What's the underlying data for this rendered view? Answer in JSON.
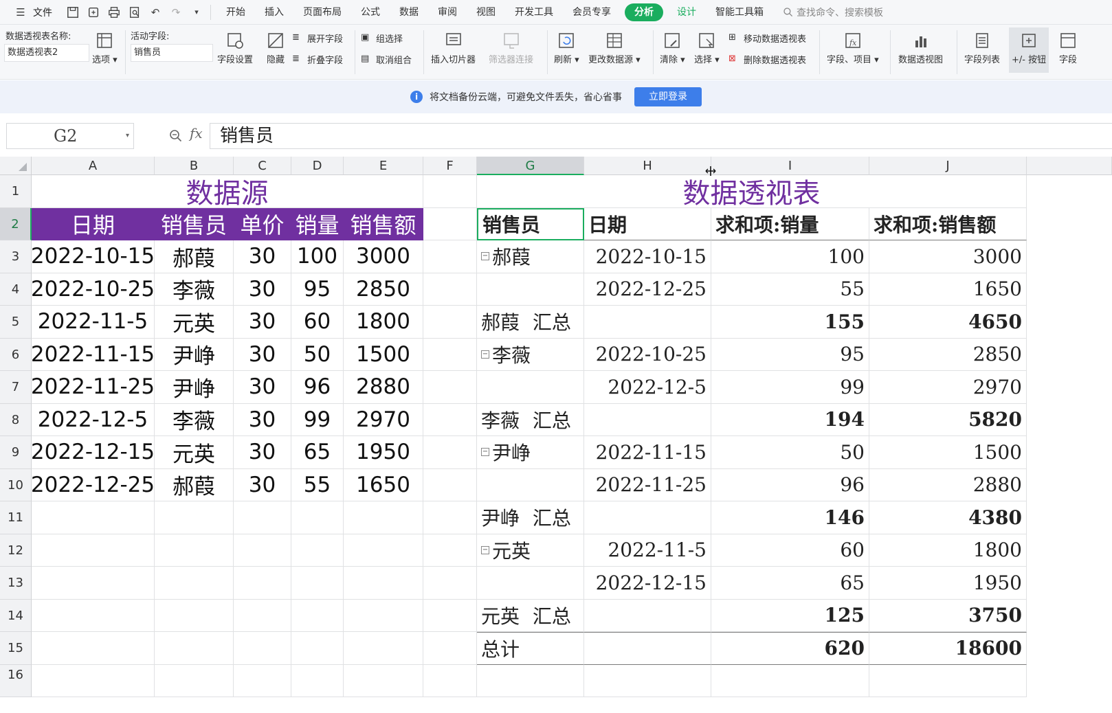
{
  "menubar": {
    "file": "文件",
    "tabs": [
      "开始",
      "插入",
      "页面布局",
      "公式",
      "数据",
      "审阅",
      "视图",
      "开发工具",
      "会员专享"
    ],
    "active_tab": "分析",
    "design_tab": "设计",
    "tools_tab": "智能工具箱",
    "search": "查找命令、搜索模板"
  },
  "ribbon": {
    "pivot_name_label": "数据透视表名称:",
    "pivot_name_value": "数据透视表2",
    "options": "选项",
    "active_field_label": "活动字段:",
    "active_field_value": "销售员",
    "field_settings": "字段设置",
    "hide": "隐藏",
    "expand_field": "展开字段",
    "collapse_field": "折叠字段",
    "group_select": "组选择",
    "ungroup": "取消组合",
    "insert_slicer": "插入切片器",
    "filter_connect": "筛选器连接",
    "refresh": "刷新",
    "change_source": "更改数据源",
    "clear": "清除",
    "select": "选择",
    "move_pivot": "移动数据透视表",
    "delete_pivot": "删除数据透视表",
    "fields_items": "字段、项目",
    "pivot_chart": "数据透视图",
    "field_list": "字段列表",
    "plus_minus_button": "+/- 按钮",
    "field_header": "字段"
  },
  "notice": {
    "text": "将文档备份云端，可避免文件丢失，省心省事",
    "button": "立即登录"
  },
  "formula_bar": {
    "cell_ref": "G2",
    "fx": "fx",
    "content": "销售员"
  },
  "sheet": {
    "columns": [
      "A",
      "B",
      "C",
      "D",
      "E",
      "F",
      "G",
      "H",
      "I",
      "J"
    ],
    "rows": [
      "1",
      "2",
      "3",
      "4",
      "5",
      "6",
      "7",
      "8",
      "9",
      "10",
      "11",
      "12",
      "13",
      "14",
      "15",
      "16"
    ],
    "source_title": "数据源",
    "source_headers": [
      "日期",
      "销售员",
      "单价",
      "销量",
      "销售额"
    ],
    "source_rows": [
      [
        "2022-10-15",
        "郝葭",
        "30",
        "100",
        "3000"
      ],
      [
        "2022-10-25",
        "李薇",
        "30",
        "95",
        "2850"
      ],
      [
        "2022-11-5",
        "元英",
        "30",
        "60",
        "1800"
      ],
      [
        "2022-11-15",
        "尹峥",
        "30",
        "50",
        "1500"
      ],
      [
        "2022-11-25",
        "尹峥",
        "30",
        "96",
        "2880"
      ],
      [
        "2022-12-5",
        "李薇",
        "30",
        "99",
        "2970"
      ],
      [
        "2022-12-15",
        "元英",
        "30",
        "65",
        "1950"
      ],
      [
        "2022-12-25",
        "郝葭",
        "30",
        "55",
        "1650"
      ]
    ],
    "pivot_title": "数据透视表",
    "pivot_headers": [
      "销售员",
      "日期",
      "求和项:销量",
      "求和项:销售额"
    ],
    "pivot_rows": [
      {
        "type": "item",
        "name": "郝葭",
        "date": "2022-10-15",
        "qty": "100",
        "amount": "3000"
      },
      {
        "type": "item",
        "name": "",
        "date": "2022-12-25",
        "qty": "55",
        "amount": "1650"
      },
      {
        "type": "subtotal",
        "name": "郝葭 汇总",
        "date": "",
        "qty": "155",
        "amount": "4650"
      },
      {
        "type": "item",
        "name": "李薇",
        "date": "2022-10-25",
        "qty": "95",
        "amount": "2850"
      },
      {
        "type": "item",
        "name": "",
        "date": "2022-12-5",
        "qty": "99",
        "amount": "2970"
      },
      {
        "type": "subtotal",
        "name": "李薇 汇总",
        "date": "",
        "qty": "194",
        "amount": "5820"
      },
      {
        "type": "item",
        "name": "尹峥",
        "date": "2022-11-15",
        "qty": "50",
        "amount": "1500"
      },
      {
        "type": "item",
        "name": "",
        "date": "2022-11-25",
        "qty": "96",
        "amount": "2880"
      },
      {
        "type": "subtotal",
        "name": "尹峥 汇总",
        "date": "",
        "qty": "146",
        "amount": "4380"
      },
      {
        "type": "item",
        "name": "元英",
        "date": "2022-11-5",
        "qty": "60",
        "amount": "1800"
      },
      {
        "type": "item",
        "name": "",
        "date": "2022-12-15",
        "qty": "65",
        "amount": "1950"
      },
      {
        "type": "subtotal",
        "name": "元英 汇总",
        "date": "",
        "qty": "125",
        "amount": "3750"
      },
      {
        "type": "total",
        "name": "总计",
        "date": "",
        "qty": "620",
        "amount": "18600"
      }
    ]
  },
  "colors": {
    "accent_green": "#1aad5e",
    "purple": "#7030a0",
    "login_blue": "#3d7eea"
  }
}
